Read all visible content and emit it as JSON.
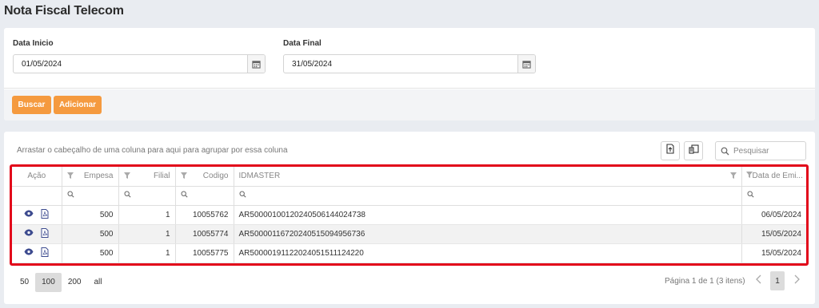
{
  "page": {
    "title": "Nota Fiscal Telecom"
  },
  "filters": {
    "start": {
      "label": "Data Inicio",
      "value": "01/05/2024"
    },
    "end": {
      "label": "Data Final",
      "value": "31/05/2024"
    },
    "search_button": "Buscar",
    "add_button": "Adicionar"
  },
  "grid": {
    "group_hint": "Arrastar o cabeçalho de uma coluna para aqui para agrupar por essa coluna",
    "search_placeholder": "Pesquisar",
    "columns": [
      "Ação",
      "Empesa",
      "Filial",
      "Codigo",
      "IDMASTER",
      "Data de Emi..."
    ],
    "rows": [
      {
        "empresa": "500",
        "filial": "1",
        "codigo": "10055762",
        "idmaster": "AR5000010012024050614402473­8",
        "data": "06/05/2024"
      },
      {
        "empresa": "500",
        "filial": "1",
        "codigo": "10055774",
        "idmaster": "AR50000116720240515094956736",
        "data": "15/05/2024"
      },
      {
        "empresa": "500",
        "filial": "1",
        "codigo": "10055775",
        "idmaster": "AR50000191122024051511124220",
        "data": "15/05/2024"
      }
    ],
    "colors": {
      "accent": "#f59a3f",
      "highlight_frame": "#e2061a",
      "icon_blue": "#3d4b8f"
    }
  },
  "pager": {
    "sizes": [
      "50",
      "100",
      "200",
      "all"
    ],
    "selected_size": "100",
    "info": "Página 1 de 1 (3 itens)",
    "current_page": "1"
  }
}
